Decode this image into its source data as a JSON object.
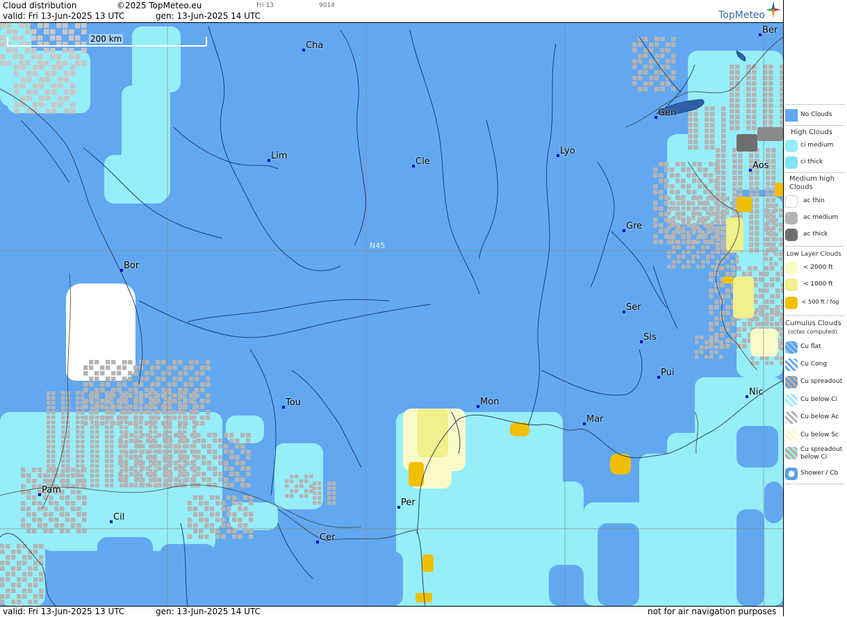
{
  "header": {
    "title": "Cloud distribution",
    "copyright": "©2025 TopMeteo.eu",
    "small_date": "Fri 13",
    "small_code": "9014",
    "valid": "valid:  Fri  13-Jun-2025  13 UTC",
    "gen": "gen: 13-Jun-2025 14 UTC",
    "logo": "TopMeteo"
  },
  "footer": {
    "valid": "valid:  Fri  13-Jun-2025  13 UTC",
    "gen": "gen: 13-Jun-2025 14 UTC",
    "disclaimer": "not for air navigation purposes"
  },
  "map": {
    "scale_label": "200 km",
    "latitude_label": "N45",
    "colors": {
      "no_clouds": "#62a8f0",
      "ci_medium": "#96eef8",
      "ac_thin": "#ffffff",
      "ac_medium": "#b4b4b4",
      "ac_thick": "#6e6e6e",
      "low_2000": "#fafac8",
      "low_1000": "#f0f08c",
      "low_500": "#f0c000",
      "city": "#0000d0"
    },
    "cities": [
      {
        "name": "Cha"
      },
      {
        "name": "Ber"
      },
      {
        "name": "Gen"
      },
      {
        "name": "Lim"
      },
      {
        "name": "Cle"
      },
      {
        "name": "Lyo"
      },
      {
        "name": "Aos"
      },
      {
        "name": "Gre"
      },
      {
        "name": "Bor"
      },
      {
        "name": "Ser"
      },
      {
        "name": "Sis"
      },
      {
        "name": "Pui"
      },
      {
        "name": "Tou"
      },
      {
        "name": "Mon"
      },
      {
        "name": "Mar"
      },
      {
        "name": "Nic"
      },
      {
        "name": "Pam"
      },
      {
        "name": "Cil"
      },
      {
        "name": "Per"
      },
      {
        "name": "Cer"
      }
    ]
  },
  "legend": {
    "no_clouds": "No Clouds",
    "high_title": "High Clouds",
    "ci_medium": "ci medium",
    "ci_thick": "ci thick",
    "medium_title": "Medium high Clouds",
    "ac_thin": "ac thin",
    "ac_medium": "ac medium",
    "ac_thick": "ac thick",
    "low_title": "Low Layer Clouds",
    "low_2000": "< 2000 ft",
    "low_1000": "< 1000 ft",
    "low_500": "< 500 ft / fog",
    "cu_title": "Cumulus Clouds",
    "cu_sub": "(octas computed)",
    "cu_flat": "Cu flat",
    "cu_cong": "Cu Cong",
    "cu_spread": "Cu spreadout",
    "cu_below_ci": "Cu below Ci",
    "cu_below_ac": "Cu below Ac",
    "cu_below_sc": "Cu below Sc",
    "cu_spread_ci": "Cu spreadout below Ci",
    "shower": "Shower / Cb"
  }
}
